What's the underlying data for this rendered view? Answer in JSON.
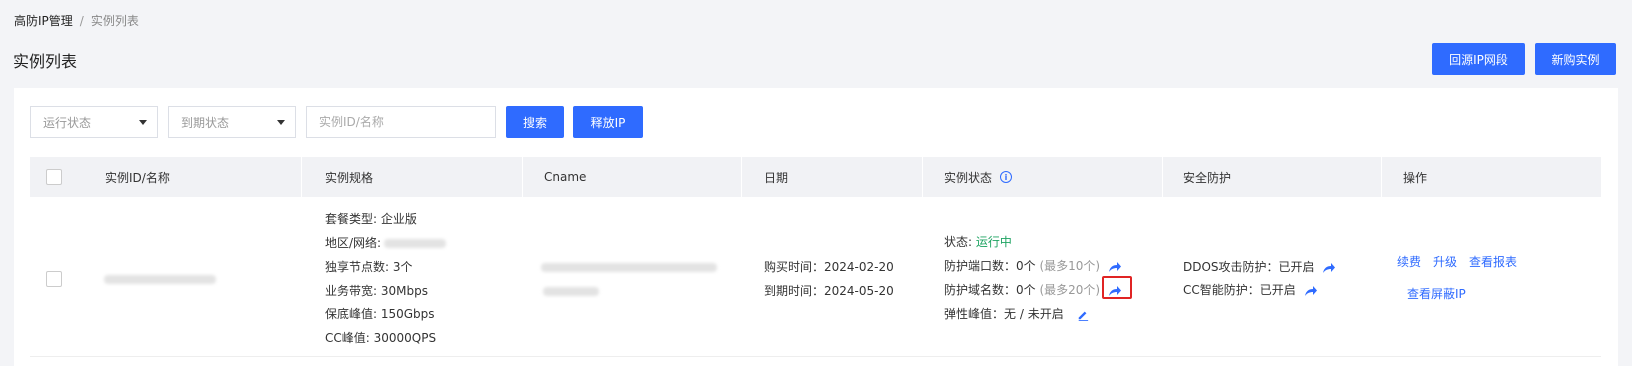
{
  "breadcrumb": {
    "parent": "高防IP管理",
    "separator": "/",
    "current": "实例列表"
  },
  "page_title": "实例列表",
  "actions": {
    "backsrc_label": "回源IP网段",
    "buy_label": "新购实例"
  },
  "filters": {
    "run_status": "运行状态",
    "expire_status": "到期状态",
    "search_placeholder": "实例ID/名称",
    "search_button": "搜索",
    "release_button": "释放IP"
  },
  "table": {
    "headers": [
      "实例ID/名称",
      "实例规格",
      "Cname",
      "日期",
      "实例状态",
      "安全防护",
      "操作"
    ],
    "row": {
      "spec": {
        "package": "套餐类型: 企业版",
        "region": "地区/网络: ",
        "nodes": "独享节点数: 3个",
        "bandwidth": "业务带宽: 30Mbps",
        "base_peak": "保底峰值: 150Gbps",
        "cc_peak": "CC峰值: 30000QPS"
      },
      "date": {
        "buy": "购买时间：2024-02-20",
        "expire": "到期时间：2024-05-20"
      },
      "status": {
        "state_label": "状态: ",
        "state_value": "运行中",
        "ports_label": "防护端口数：",
        "ports_value": "0个",
        "ports_max": "(最多10个)",
        "domains_label": "防护域名数：",
        "domains_value": "0个",
        "domains_max": "(最多20个)",
        "elastic_label": "弹性峰值：",
        "elastic_value": "无 / 未开启"
      },
      "protection": {
        "ddos_label": "DDOS攻击防护：",
        "ddos_value": "已开启",
        "cc_label": "CC智能防护：",
        "cc_value": "已开启"
      },
      "ops": {
        "renew": "续费",
        "upgrade": "升级",
        "report": "查看报表",
        "blocked": "查看屏蔽IP"
      }
    }
  },
  "colors": {
    "primary": "#2f6bff",
    "success": "#1ea362",
    "highlight": "#e02424"
  }
}
